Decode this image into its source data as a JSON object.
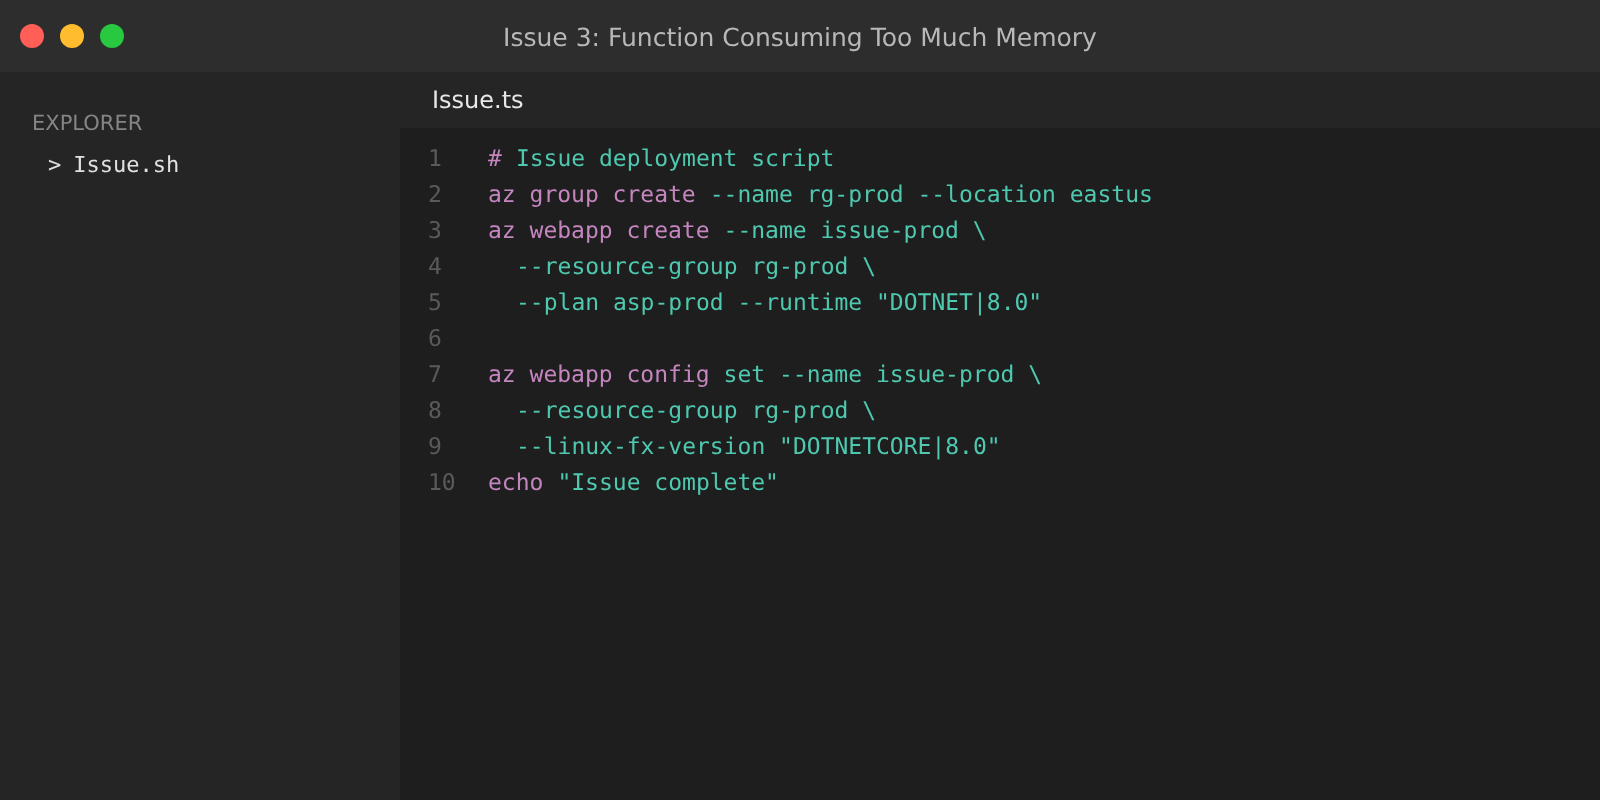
{
  "window": {
    "title": "Issue 3: Function Consuming Too Much Memory",
    "controls": [
      {
        "color": "#ff5f57"
      },
      {
        "color": "#febc2e"
      },
      {
        "color": "#28c840"
      }
    ]
  },
  "sidebar": {
    "title": "EXPLORER",
    "items": [
      {
        "chevron": ">",
        "label": "Issue.sh"
      }
    ]
  },
  "tabs": [
    {
      "label": "Issue.ts",
      "selected": true
    }
  ],
  "editor": {
    "lines": [
      {
        "number": "1",
        "tokens": [
          {
            "kind": "keyword",
            "text": "#"
          },
          {
            "kind": "text",
            "text": "Issue deployment script"
          }
        ]
      },
      {
        "number": "2",
        "tokens": [
          {
            "kind": "keyword",
            "text": "az group create"
          },
          {
            "kind": "text",
            "text": "--name rg-prod --location eastus"
          }
        ]
      },
      {
        "number": "3",
        "tokens": [
          {
            "kind": "keyword",
            "text": "az webapp create"
          },
          {
            "kind": "text",
            "text": "--name issue-prod \\"
          }
        ]
      },
      {
        "number": "4",
        "tokens": [
          {
            "kind": "indent",
            "text": "--resource-group rg-prod \\"
          }
        ]
      },
      {
        "number": "5",
        "tokens": [
          {
            "kind": "indent",
            "text": "--plan asp-prod --runtime \"DOTNET|8.0\""
          }
        ]
      },
      {
        "number": "6"
      },
      {
        "number": "7",
        "tokens": [
          {
            "kind": "keyword",
            "text": "az webapp config"
          },
          {
            "kind": "text",
            "text": "set --name issue-prod \\"
          }
        ]
      },
      {
        "number": "8",
        "tokens": [
          {
            "kind": "indent",
            "text": "--resource-group rg-prod \\"
          }
        ]
      },
      {
        "number": "9",
        "tokens": [
          {
            "kind": "indent",
            "text": "--linux-fx-version \"DOTNETCORE|8.0\""
          }
        ]
      },
      {
        "number": "10",
        "tokens": [
          {
            "kind": "keyword",
            "text": "echo"
          },
          {
            "kind": "text",
            "text": "\"Issue complete\""
          }
        ]
      }
    ]
  }
}
